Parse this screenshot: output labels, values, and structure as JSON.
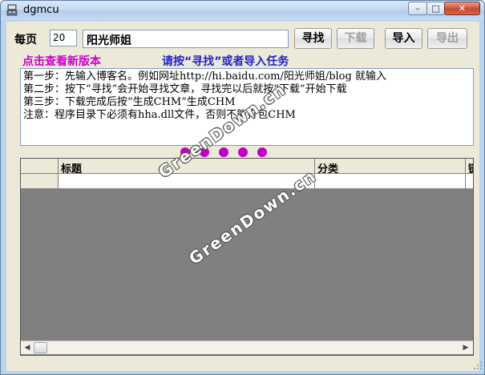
{
  "window": {
    "title": "dgmcu",
    "icon": "app-icon",
    "caption_buttons": {
      "minimize": "–",
      "maximize": "□",
      "close": "✕"
    }
  },
  "toolbar": {
    "per_page_label": "每页",
    "per_page_value": "20",
    "blog_name_value": "阳光师姐",
    "search_label": "寻找",
    "download_label": "下载",
    "import_label": "导入",
    "export_label": "导出"
  },
  "links": {
    "new_version": "点击查看新版本",
    "notice": "请按“寻找”或者导入任务"
  },
  "instructions": [
    "第一步：先输入博客名。例如网址http://hi.baidu.com/阳光师姐/blog 就输入",
    "第二步：按下“寻找”会开始寻找文章，寻找完以后就按“下载”开始下载",
    "第三步：下载完成后按“生成CHM”生成CHM",
    "注意：程序目录下必须有hha.dll文件，否则不能打包CHM"
  ],
  "progress_dots": 5,
  "table": {
    "columns": [
      "",
      "标题",
      "分类",
      "链"
    ]
  },
  "watermarks": [
    "GreenDown.cn",
    "GreenDown.cn"
  ],
  "colors": {
    "link_magenta": "#cc00cc",
    "notice_blue": "#2222cc",
    "dot_color": "#c000c0"
  }
}
